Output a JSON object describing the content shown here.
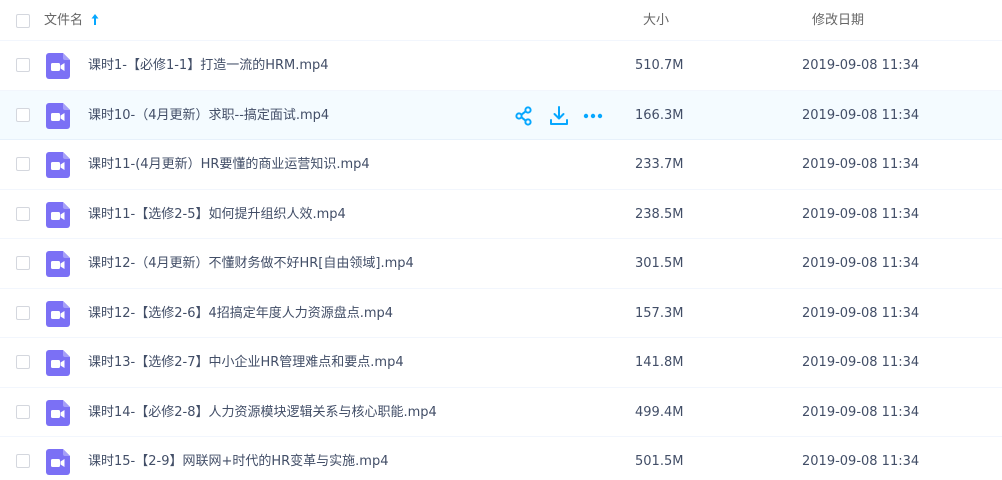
{
  "header": {
    "name_label": "文件名",
    "size_label": "大小",
    "date_label": "修改日期"
  },
  "icons": {
    "sort": "arrow-up-icon",
    "file": "video-file-icon",
    "share": "share-icon",
    "download": "download-icon",
    "more": "more-icon"
  },
  "colors": {
    "accent": "#06a7ff",
    "video_icon": "#7b70f5",
    "hover_row": "#f4fbff"
  },
  "files": [
    {
      "name": "课时1-【必修1-1】打造一流的HRM.mp4",
      "size": "510.7M",
      "date": "2019-09-08 11:34"
    },
    {
      "name": "课时10-（4月更新）求职--搞定面试.mp4",
      "size": "166.3M",
      "date": "2019-09-08 11:34"
    },
    {
      "name": "课时11-(4月更新）HR要懂的商业运营知识.mp4",
      "size": "233.7M",
      "date": "2019-09-08 11:34"
    },
    {
      "name": "课时11-【选修2-5】如何提升组织人效.mp4",
      "size": "238.5M",
      "date": "2019-09-08 11:34"
    },
    {
      "name": "课时12-（4月更新）不懂财务做不好HR[自由领域].mp4",
      "size": "301.5M",
      "date": "2019-09-08 11:34"
    },
    {
      "name": "课时12-【选修2-6】4招搞定年度人力资源盘点.mp4",
      "size": "157.3M",
      "date": "2019-09-08 11:34"
    },
    {
      "name": "课时13-【选修2-7】中小企业HR管理难点和要点.mp4",
      "size": "141.8M",
      "date": "2019-09-08 11:34"
    },
    {
      "name": "课时14-【必修2-8】人力资源模块逻辑关系与核心职能.mp4",
      "size": "499.4M",
      "date": "2019-09-08 11:34"
    },
    {
      "name": "课时15-【2-9】网联网+时代的HR变革与实施.mp4",
      "size": "501.5M",
      "date": "2019-09-08 11:34"
    }
  ],
  "hovered_row": 1
}
